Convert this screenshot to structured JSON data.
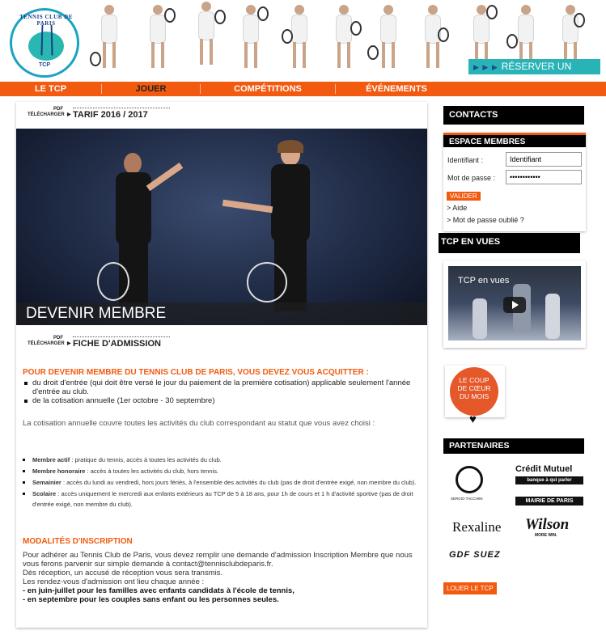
{
  "header": {
    "logo_text": "TENNIS CLUB DE PARIS",
    "logo_sub": "TCP",
    "reserve_label": "RÉSERVER UN COURT",
    "reserve_arrows": "▶ ▶ ▶"
  },
  "nav": {
    "items": [
      {
        "label": "LE TCP"
      },
      {
        "label": "JOUER"
      },
      {
        "label": "COMPÉTITIONS"
      },
      {
        "label": "ÉVÉNEMENTS"
      }
    ]
  },
  "main": {
    "pdf_label": "PDF",
    "download_label": "TÉLÉCHARGER",
    "tarif_title": "TARIF 2016 / 2017",
    "hero_caption": "DEVENIR MEMBRE",
    "fiche_title": "FICHE D'ADMISSION",
    "section1_title": "POUR DEVENIR MEMBRE DU TENNIS CLUB DE PARIS, VOUS DEVEZ VOUS ACQUITTER :",
    "section1_bullets": [
      "du droit d'entrée (qui doit être versé le jour du paiement de la première cotisation) applicable seulement l'année d'entrée au club.",
      "de la cotisation annuelle (1er octobre - 30 septembre)"
    ],
    "cotisation_text": "La cotisation annuelle couvre toutes les activités du club correspondant au statut que vous avez choisi :",
    "status_list": [
      {
        "name": "Membre actif",
        "desc": " : pratique du tennis, accès à toutes les activités du club."
      },
      {
        "name": "Membre honoraire",
        "desc": " : accès à toutes les activités du club, hors tennis."
      },
      {
        "name": "Semainier",
        "desc": " : accès du lundi au vendredi, hors jours fériés, à l'ensemble des activités du club (pas de droit d'entrée exigé, non membre du club)."
      },
      {
        "name": "Scolaire",
        "desc": " : accès uniquement le mercredi aux enfants extérieurs au TCP de 5 à 18 ans, pour 1h de cours et 1 h d'activité sportive (pas de droit d'entrée exigé, non membre du club)."
      }
    ],
    "section2_title": "MODALITÉS D'INSCRIPTION",
    "inscription_lines": [
      "Pour adhérer au Tennis Club de Paris, vous devez remplir une demande d'admission Inscription Membre que nous vous ferons parvenir sur simple demande à contact@tennisclubdeparis.fr.",
      "Dès réception, un accusé de réception vous sera transmis.",
      "Les rendez-vous d'admission ont lieu chaque année :"
    ],
    "inscription_bold": [
      "- en juin-juillet pour les familles avec enfants candidats à l'école de tennis,",
      "- en septembre pour les couples sans enfant ou les personnes seules."
    ]
  },
  "sidebar": {
    "contacts": "CONTACTS",
    "members_title": "ESPACE MEMBRES",
    "identifiant_label": "Identifiant :",
    "identifiant_value": "Identifiant",
    "password_label": "Mot de passe :",
    "password_value": "••••••••••••",
    "valider": "VALIDER",
    "aide": "> Aide",
    "forgot": "> Mot de passe oublié ?",
    "tcp_en_vues": "TCP EN VUES",
    "video_title": "TCP en vues",
    "coeur_text_1": "LE COUP",
    "coeur_text_2": "DE CŒUR",
    "coeur_text_3": "DU MOIS",
    "partenaires": "PARTENAIRES",
    "partners": [
      "SERGIO TACCHINI",
      "Crédit Mutuel",
      "banque à qui parler",
      "MAIRIE DE PARIS",
      "Rexaline",
      "Wilson",
      "MORE WIN.",
      "GDF SUEZ"
    ],
    "louer": "LOUER LE TCP"
  }
}
